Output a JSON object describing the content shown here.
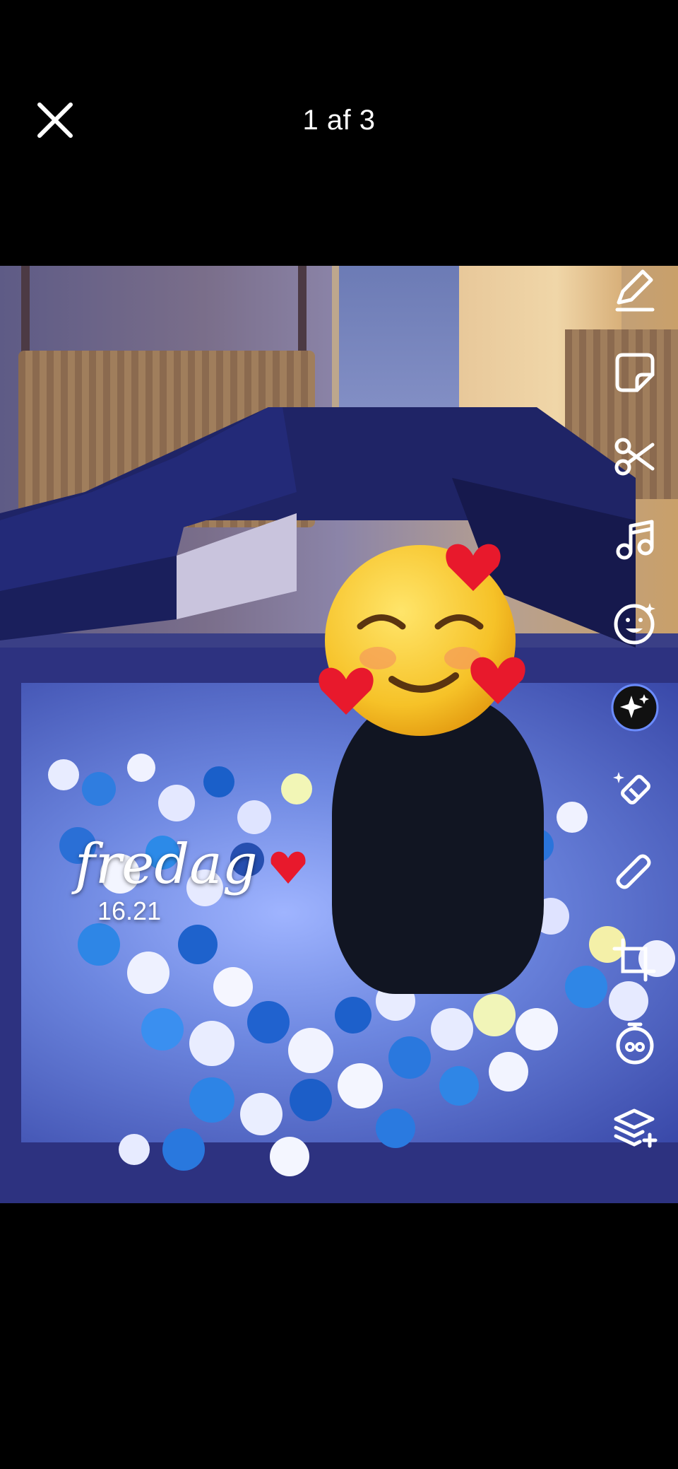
{
  "header": {
    "counter_label": "1 af 3"
  },
  "story": {
    "day_text": "fredag",
    "time_text": "16.21"
  },
  "toolbar": {
    "items": [
      {
        "name": "pen",
        "icon": "pen-icon"
      },
      {
        "name": "sticker",
        "icon": "sticker-icon"
      },
      {
        "name": "scissors",
        "icon": "scissors-icon"
      },
      {
        "name": "music",
        "icon": "music-note-icon"
      },
      {
        "name": "emoji",
        "icon": "smiley-icon"
      },
      {
        "name": "ai-sparkle",
        "icon": "sparkle-icon"
      },
      {
        "name": "eraser",
        "icon": "eraser-icon"
      },
      {
        "name": "attachment",
        "icon": "paperclip-icon"
      },
      {
        "name": "crop",
        "icon": "crop-icon"
      },
      {
        "name": "timer",
        "icon": "timer-icon"
      },
      {
        "name": "layers",
        "icon": "layers-icon"
      }
    ]
  },
  "colors": {
    "background": "#000000",
    "icon": "#ffffff",
    "heart": "#e8192c",
    "emoji_face": "#f7c630"
  }
}
